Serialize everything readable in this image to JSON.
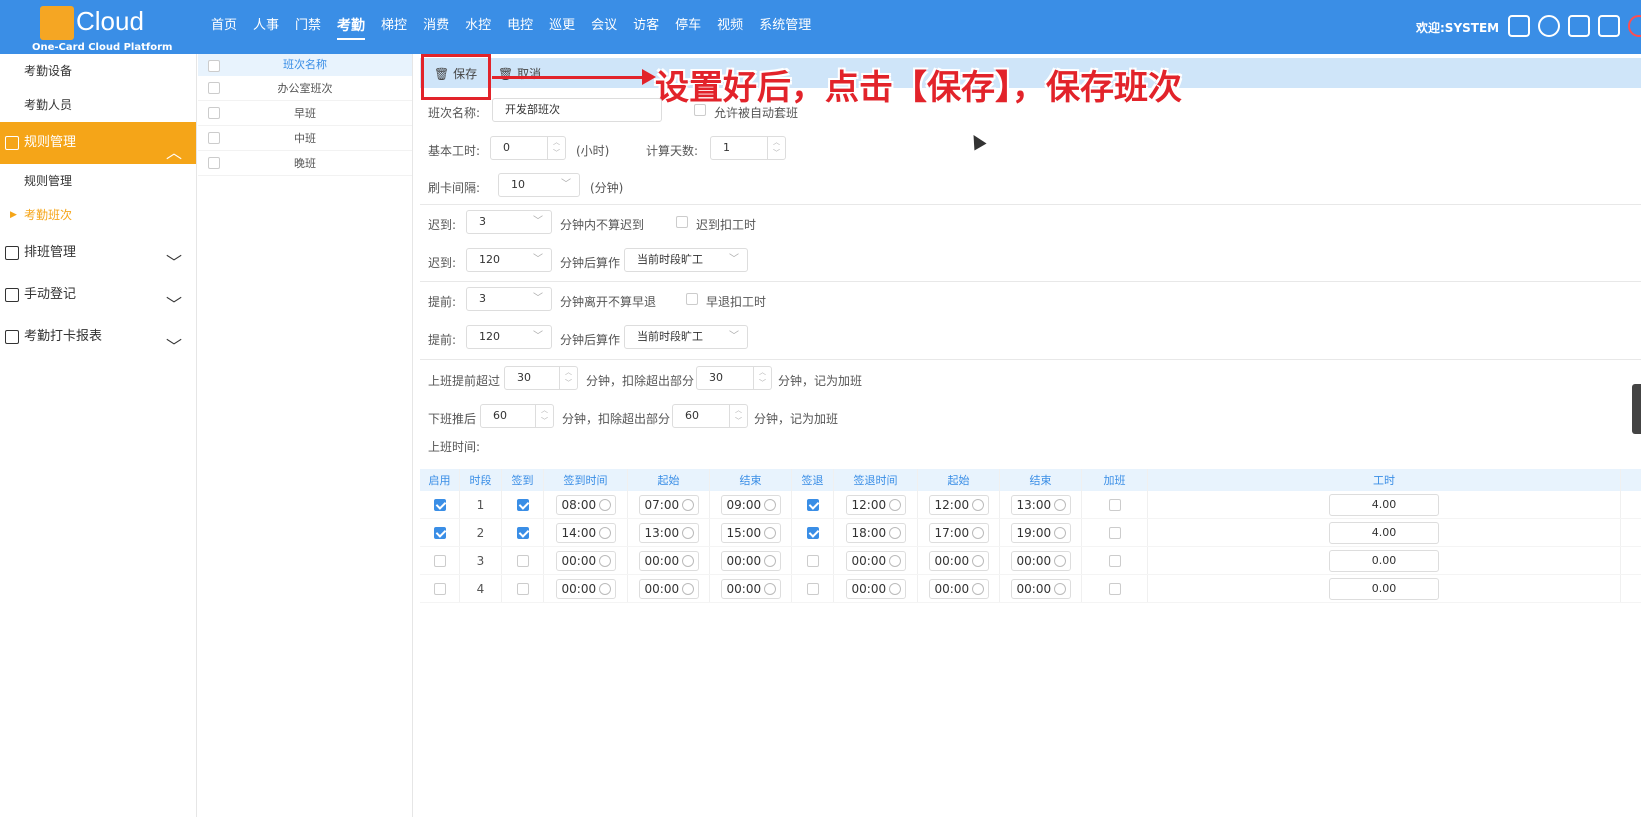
{
  "header": {
    "logo_text": "Cloud",
    "logo_sub": "One-Card Cloud Platform",
    "nav": [
      "首页",
      "人事",
      "门禁",
      "考勤",
      "梯控",
      "消费",
      "水控",
      "电控",
      "巡更",
      "会议",
      "访客",
      "停车",
      "视频",
      "系统管理"
    ],
    "active_nav": "考勤",
    "welcome": "欢迎:SYSTEM",
    "icons": [
      "fullscreen-icon",
      "help-icon",
      "language-icon",
      "external-link-icon",
      "power-icon"
    ]
  },
  "sidebar": {
    "items": [
      {
        "label": "考勤设备",
        "kind": "sub"
      },
      {
        "label": "考勤人员",
        "kind": "sub"
      },
      {
        "label": "规则管理",
        "kind": "group",
        "active": true,
        "icon": "rules-icon",
        "chevron": "︿"
      },
      {
        "label": "规则管理",
        "kind": "sub"
      },
      {
        "label": "考勤班次",
        "kind": "sub",
        "current": true
      },
      {
        "label": "排班管理",
        "kind": "group",
        "icon": "schedule-icon",
        "chevron": "﹀"
      },
      {
        "label": "手动登记",
        "kind": "group",
        "icon": "hand-icon",
        "chevron": "﹀"
      },
      {
        "label": "考勤打卡报表",
        "kind": "group",
        "icon": "report-icon",
        "chevron": "﹀"
      }
    ]
  },
  "shift_list": {
    "header": "班次名称",
    "rows": [
      "办公室班次",
      "早班",
      "中班",
      "晚班"
    ]
  },
  "toolbar": {
    "save": "保存",
    "cancel": "取消"
  },
  "annotation": "设置好后，点击【保存】，保存班次",
  "form": {
    "shift_name_label": "班次名称:",
    "shift_name_value": "开发部班次",
    "auto_shift_label": "允许被自动套班",
    "base_hours_label": "基本工时:",
    "base_hours_value": "0",
    "hours_unit": "(小时)",
    "calc_days_label": "计算天数:",
    "calc_days_value": "1",
    "card_interval_label": "刷卡间隔:",
    "card_interval_value": "10",
    "minute_unit": "(分钟)",
    "late1_label": "迟到:",
    "late1_value": "3",
    "late1_text": "分钟内不算迟到",
    "late_deduct_label": "迟到扣工时",
    "late2_label": "迟到:",
    "late2_value": "120",
    "late2_text": "分钟后算作",
    "late2_select": "当前时段旷工",
    "early1_label": "提前:",
    "early1_value": "3",
    "early1_text": "分钟离开不算早退",
    "early_deduct_label": "早退扣工时",
    "early2_label": "提前:",
    "early2_value": "120",
    "early2_text": "分钟后算作",
    "early2_select": "当前时段旷工",
    "ot_before_label": "上班提前超过",
    "ot_before_value": "30",
    "ot_before_mid": "分钟，扣除超出部分",
    "ot_before_value2": "30",
    "ot_before_end": "分钟，记为加班",
    "ot_after_label": "下班推后",
    "ot_after_value": "60",
    "ot_after_mid": "分钟，扣除超出部分",
    "ot_after_value2": "60",
    "ot_after_end": "分钟，记为加班",
    "work_time_label": "上班时间:"
  },
  "time_table": {
    "headers": [
      "启用",
      "时段",
      "签到",
      "签到时间",
      "起始",
      "结束",
      "签退",
      "签退时间",
      "起始",
      "结束",
      "加班",
      "工时"
    ],
    "rows": [
      {
        "enabled": true,
        "period": "1",
        "checkin": true,
        "checkin_time": "08:00",
        "ci_start": "07:00",
        "ci_end": "09:00",
        "checkout": true,
        "checkout_time": "12:00",
        "co_start": "12:00",
        "co_end": "13:00",
        "overtime": false,
        "hours": "4.00"
      },
      {
        "enabled": true,
        "period": "2",
        "checkin": true,
        "checkin_time": "14:00",
        "ci_start": "13:00",
        "ci_end": "15:00",
        "checkout": true,
        "checkout_time": "18:00",
        "co_start": "17:00",
        "co_end": "19:00",
        "overtime": false,
        "hours": "4.00"
      },
      {
        "enabled": false,
        "period": "3",
        "checkin": false,
        "checkin_time": "00:00",
        "ci_start": "00:00",
        "ci_end": "00:00",
        "checkout": false,
        "checkout_time": "00:00",
        "co_start": "00:00",
        "co_end": "00:00",
        "overtime": false,
        "hours": "0.00"
      },
      {
        "enabled": false,
        "period": "4",
        "checkin": false,
        "checkin_time": "00:00",
        "ci_start": "00:00",
        "ci_end": "00:00",
        "checkout": false,
        "checkout_time": "00:00",
        "co_start": "00:00",
        "co_end": "00:00",
        "overtime": false,
        "hours": "0.00"
      }
    ]
  },
  "colors": {
    "primary": "#3a8ee6",
    "accent": "#f5a518",
    "annotation": "#e2232a"
  }
}
